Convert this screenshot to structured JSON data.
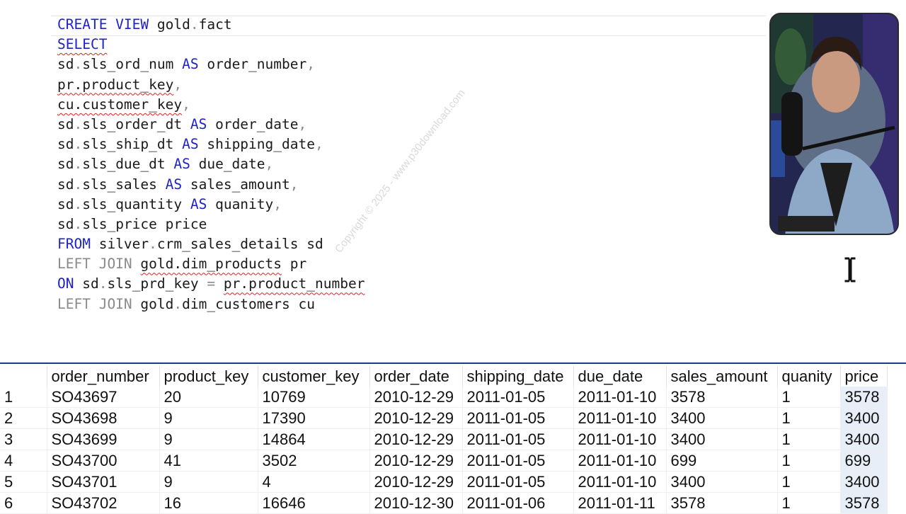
{
  "editor": {
    "lines": [
      [
        {
          "t": "CREATE VIEW",
          "c": "kw"
        },
        {
          "t": " gold",
          "c": ""
        },
        {
          "t": ".",
          "c": "punct"
        },
        {
          "t": "fact",
          "c": ""
        }
      ],
      [
        {
          "t": "SELECT",
          "c": "kw squiggle"
        }
      ],
      [
        {
          "t": "sd",
          "c": ""
        },
        {
          "t": ".",
          "c": "punct"
        },
        {
          "t": "sls_ord_num ",
          "c": ""
        },
        {
          "t": "AS",
          "c": "kw"
        },
        {
          "t": " order_number",
          "c": ""
        },
        {
          "t": ",",
          "c": "punct"
        }
      ],
      [
        {
          "t": "pr.product_key",
          "c": "squiggle"
        },
        {
          "t": ",",
          "c": "punct"
        }
      ],
      [
        {
          "t": "cu.customer_key",
          "c": "squiggle"
        },
        {
          "t": ",",
          "c": "punct"
        }
      ],
      [
        {
          "t": "sd",
          "c": ""
        },
        {
          "t": ".",
          "c": "punct"
        },
        {
          "t": "sls_order_dt ",
          "c": ""
        },
        {
          "t": "AS",
          "c": "kw"
        },
        {
          "t": " order_date",
          "c": ""
        },
        {
          "t": ",",
          "c": "punct"
        }
      ],
      [
        {
          "t": "sd",
          "c": ""
        },
        {
          "t": ".",
          "c": "punct"
        },
        {
          "t": "sls_ship_dt ",
          "c": ""
        },
        {
          "t": "AS",
          "c": "kw"
        },
        {
          "t": " shipping_date",
          "c": ""
        },
        {
          "t": ",",
          "c": "punct"
        }
      ],
      [
        {
          "t": "sd",
          "c": ""
        },
        {
          "t": ".",
          "c": "punct"
        },
        {
          "t": "sls_due_dt ",
          "c": ""
        },
        {
          "t": "AS",
          "c": "kw"
        },
        {
          "t": " due_date",
          "c": ""
        },
        {
          "t": ",",
          "c": "punct"
        }
      ],
      [
        {
          "t": "sd",
          "c": ""
        },
        {
          "t": ".",
          "c": "punct"
        },
        {
          "t": "sls_sales ",
          "c": ""
        },
        {
          "t": "AS",
          "c": "kw"
        },
        {
          "t": " sales_amount",
          "c": ""
        },
        {
          "t": ",",
          "c": "punct"
        }
      ],
      [
        {
          "t": "sd",
          "c": ""
        },
        {
          "t": ".",
          "c": "punct"
        },
        {
          "t": "sls_quantity ",
          "c": ""
        },
        {
          "t": "AS",
          "c": "kw"
        },
        {
          "t": " quanity",
          "c": ""
        },
        {
          "t": ",",
          "c": "punct"
        }
      ],
      [
        {
          "t": "sd",
          "c": ""
        },
        {
          "t": ".",
          "c": "punct"
        },
        {
          "t": "sls_price price",
          "c": ""
        }
      ],
      [
        {
          "t": "FROM",
          "c": "kw"
        },
        {
          "t": " silver",
          "c": ""
        },
        {
          "t": ".",
          "c": "punct"
        },
        {
          "t": "crm_sales_details sd",
          "c": ""
        }
      ],
      [
        {
          "t": "LEFT JOIN",
          "c": "kw-gray"
        },
        {
          "t": " ",
          "c": ""
        },
        {
          "t": "gold.dim_products",
          "c": "squiggle"
        },
        {
          "t": " pr",
          "c": ""
        }
      ],
      [
        {
          "t": "ON",
          "c": "kw"
        },
        {
          "t": " sd",
          "c": ""
        },
        {
          "t": ".",
          "c": "punct"
        },
        {
          "t": "sls_prd_key ",
          "c": ""
        },
        {
          "t": "=",
          "c": "punct"
        },
        {
          "t": " ",
          "c": ""
        },
        {
          "t": "pr.product_number",
          "c": "squiggle"
        }
      ],
      [
        {
          "t": "LEFT JOIN",
          "c": "kw-gray"
        },
        {
          "t": " gold",
          "c": ""
        },
        {
          "t": ".",
          "c": "punct"
        },
        {
          "t": "dim_customers cu",
          "c": ""
        }
      ]
    ]
  },
  "watermark": "Copyright © 2025 - www.p30download.com",
  "results": {
    "columns": [
      "",
      "order_number",
      "product_key",
      "customer_key",
      "order_date",
      "shipping_date",
      "due_date",
      "sales_amount",
      "quanity",
      "price"
    ],
    "rows": [
      [
        "1",
        "SO43697",
        "20",
        "10769",
        "2010-12-29",
        "2011-01-05",
        "2011-01-10",
        "3578",
        "1",
        "3578"
      ],
      [
        "2",
        "SO43698",
        "9",
        "17390",
        "2010-12-29",
        "2011-01-05",
        "2011-01-10",
        "3400",
        "1",
        "3400"
      ],
      [
        "3",
        "SO43699",
        "9",
        "14864",
        "2010-12-29",
        "2011-01-05",
        "2011-01-10",
        "3400",
        "1",
        "3400"
      ],
      [
        "4",
        "SO43700",
        "41",
        "3502",
        "2010-12-29",
        "2011-01-05",
        "2011-01-10",
        "699",
        "1",
        "699"
      ],
      [
        "5",
        "SO43701",
        "9",
        "4",
        "2010-12-29",
        "2011-01-05",
        "2011-01-10",
        "3400",
        "1",
        "3400"
      ],
      [
        "6",
        "SO43702",
        "16",
        "16646",
        "2010-12-30",
        "2011-01-06",
        "2011-01-11",
        "3578",
        "1",
        "3578"
      ]
    ]
  },
  "colors": {
    "keyword": "#1e22c8",
    "keyword_gray": "#8a8a8a",
    "squiggle": "#e02020",
    "grid_border": "#1b3a8c",
    "selected_cell": "#e8eef7"
  },
  "icons": [
    "text-cursor-icon"
  ]
}
